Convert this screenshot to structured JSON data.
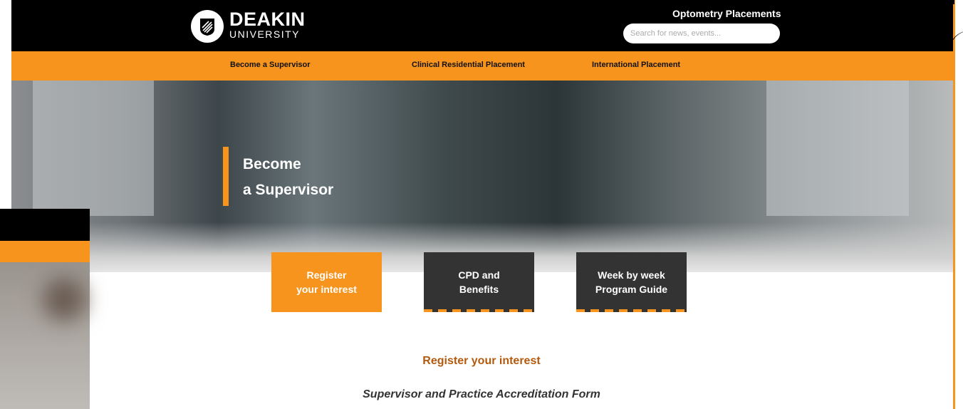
{
  "header": {
    "logo_word1": "DEAKIN",
    "logo_word2": "UNIVERSITY",
    "site_title": "Optometry  Placements",
    "search_placeholder": "Search for news, events..."
  },
  "nav": {
    "items": [
      "Become a Supervisor",
      "Clinical Residential Placement",
      "International Placement"
    ]
  },
  "hero": {
    "line1": "Become",
    "line2": "a Supervisor"
  },
  "tiles": [
    {
      "label": "Register\nyour interest"
    },
    {
      "label": "CPD and\nBenefits"
    },
    {
      "label": "Week by week\nProgram Guide"
    }
  ],
  "main": {
    "section_title": "Register your interest",
    "form_title": "Supervisor and Practice Accreditation Form"
  },
  "edge": {
    "letters": "DEAKIN"
  },
  "colors": {
    "accent": "#f7941d",
    "header": "#000000",
    "tile_dark": "#333333",
    "section_title": "#b35a0f"
  }
}
